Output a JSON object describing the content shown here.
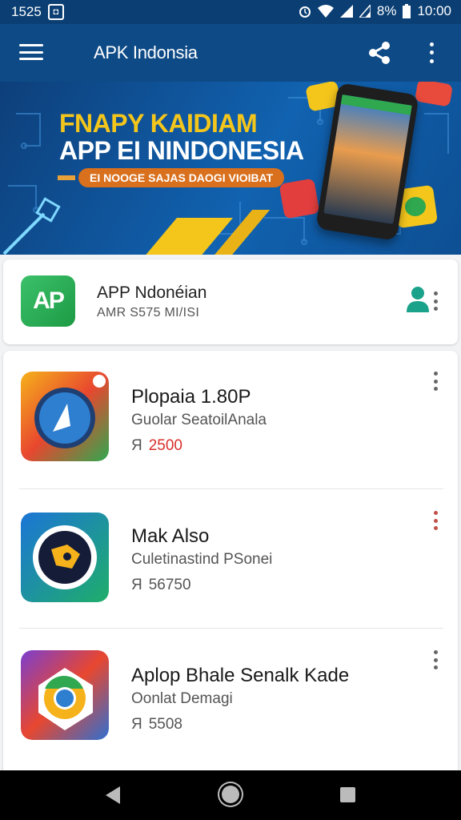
{
  "status_bar": {
    "time": "1525",
    "notification_icon": "notification-box-icon",
    "battery_percent": "8%",
    "clock": "10:00"
  },
  "app_bar": {
    "title": "APK Indonsia",
    "menu_icon": "hamburger-menu-icon",
    "share_icon": "share-icon",
    "more_icon": "more-vertical-icon"
  },
  "banner": {
    "headline_1": "FNAPY KAIDIAM",
    "headline_2": "APP EI NINDONESIA",
    "tagline": "EI NOOGE SAJAS DAOGI VIOIBAT",
    "colors": {
      "accent": "#f4c61c",
      "tag": "#d9701d",
      "background": "#1162b0"
    }
  },
  "featured": {
    "icon_text": "AP",
    "title": "APP Ndonéian",
    "subtitle": "AMR S575 MI/ISI",
    "profile_icon": "user-icon"
  },
  "apps": [
    {
      "name": "Plopaia 1.80P",
      "developer": "Guolar SeatoilAnala",
      "price_prefix": "Я",
      "price": "2500",
      "price_color": "#d8302a",
      "icon": "compass-app-icon"
    },
    {
      "name": "Mak Also",
      "developer": "Culetinastind PSonei",
      "price_prefix": "Я",
      "price": "56750",
      "price_color": "#555555",
      "icon": "fox-app-icon"
    },
    {
      "name": "Aplop Bhale Senalk Kade",
      "developer": "Oonlat Demagi",
      "price_prefix": "Я",
      "price": "5508",
      "price_color": "#555555",
      "icon": "chrome-app-icon"
    }
  ],
  "nav_bar": {
    "back_icon": "back-icon",
    "home_icon": "home-icon",
    "recents_icon": "recents-icon"
  }
}
